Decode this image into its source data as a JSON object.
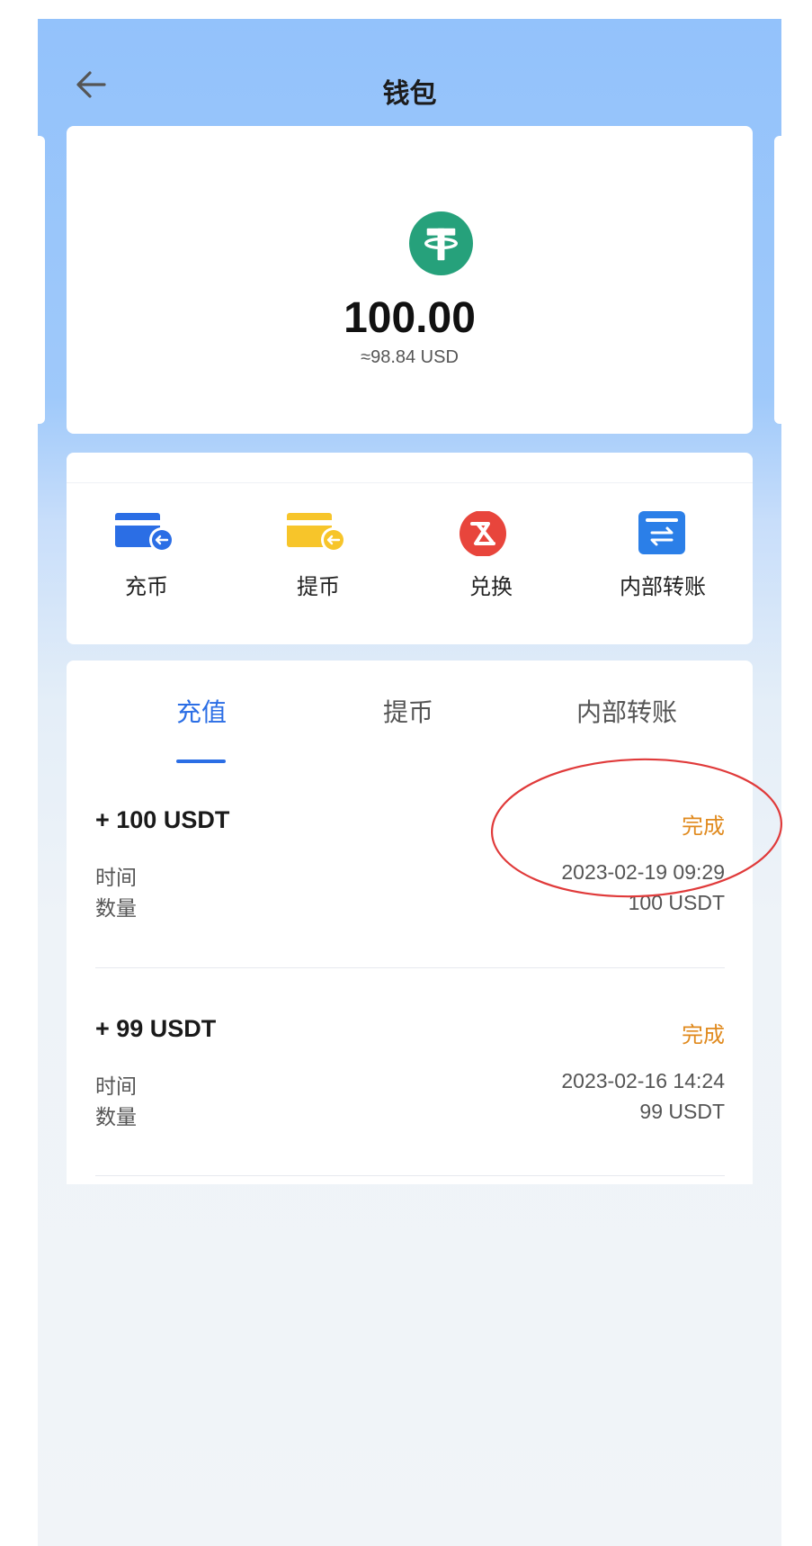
{
  "header": {
    "title": "钱包",
    "back_icon": "arrow-left-icon"
  },
  "balance": {
    "icon": "tether-usdt-icon",
    "icon_color": "#26a17b",
    "amount": "100.00",
    "usd_equivalent": "≈98.84 USD"
  },
  "actions": [
    {
      "label": "充币",
      "icon": "deposit-card-icon",
      "color": "#2b6ee5"
    },
    {
      "label": "提币",
      "icon": "withdraw-card-icon",
      "color": "#f7c52a"
    },
    {
      "label": "兑换",
      "icon": "exchange-icon",
      "color": "#e8453c"
    },
    {
      "label": "内部转账",
      "icon": "transfer-icon",
      "color": "#2b7fe8"
    }
  ],
  "tabs": [
    {
      "label": "充值",
      "active": true
    },
    {
      "label": "提币",
      "active": false
    },
    {
      "label": "内部转账",
      "active": false
    }
  ],
  "records": [
    {
      "amount": "+ 100  USDT",
      "status": "完成",
      "time_label": "时间",
      "time": "2023-02-19 09:29",
      "qty_label": "数量",
      "qty": "100 USDT"
    },
    {
      "amount": "+ 99  USDT",
      "status": "完成",
      "time_label": "时间",
      "time": "2023-02-16 14:24",
      "qty_label": "数量",
      "qty": "99 USDT"
    }
  ],
  "colors": {
    "accent": "#2b6ee5",
    "status_done": "#e08a1e",
    "annotation": "#e03a3a"
  }
}
